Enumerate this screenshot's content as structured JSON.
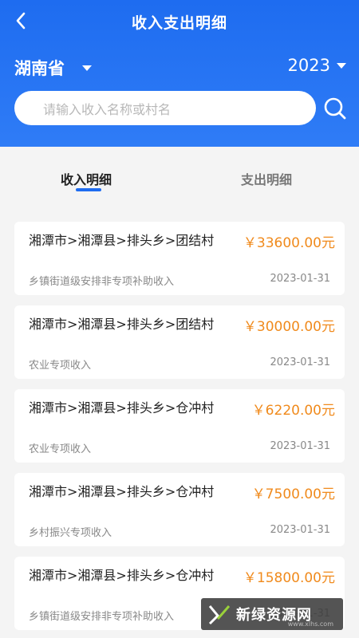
{
  "header": {
    "title": "收入支出明细",
    "province": "湖南省",
    "year": "2023",
    "search_placeholder": "请输入收入名称或村名"
  },
  "tabs": [
    {
      "label": "收入明细",
      "active": true
    },
    {
      "label": "支出明细",
      "active": false
    }
  ],
  "records": [
    {
      "place": "湘潭市>湘潭县>排头乡>团结村",
      "amount": "￥33600.00元",
      "category": "乡镇街道级安排非专项补助收入",
      "date": "2023-01-31"
    },
    {
      "place": "湘潭市>湘潭县>排头乡>团结村",
      "amount": "￥30000.00元",
      "category": "农业专项收入",
      "date": "2023-01-31"
    },
    {
      "place": "湘潭市>湘潭县>排头乡>仓冲村",
      "amount": "￥6220.00元",
      "category": "农业专项收入",
      "date": "2023-01-31"
    },
    {
      "place": "湘潭市>湘潭县>排头乡>仓冲村",
      "amount": "￥7500.00元",
      "category": "乡村振兴专项收入",
      "date": "2023-01-31"
    },
    {
      "place": "湘潭市>湘潭县>排头乡>仓冲村",
      "amount": "￥15800.00元",
      "category": "乡镇街道级安排非专项补助收入",
      "date": "2023-01-31"
    }
  ],
  "watermark": {
    "text": "新绿资源网",
    "sub": "www.xlhs.com"
  },
  "colors": {
    "primary": "#1e6cf0",
    "amount": "#f08a1c"
  }
}
